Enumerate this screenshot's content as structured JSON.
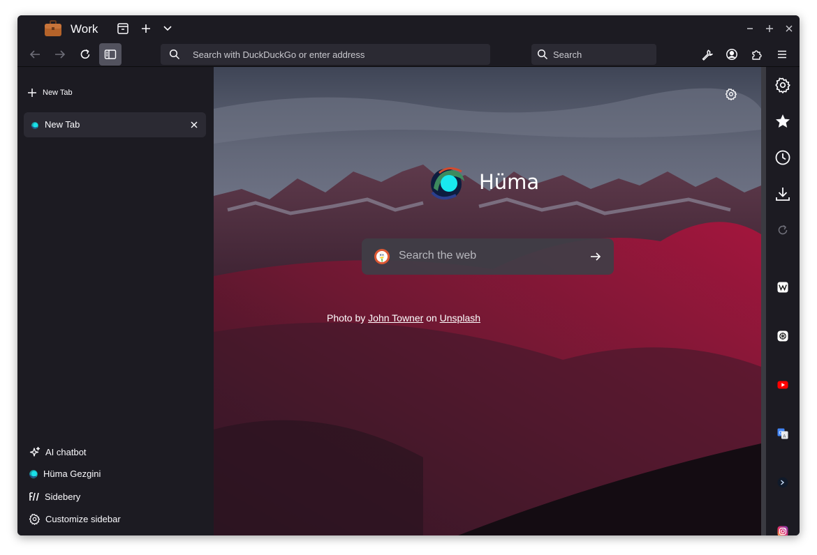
{
  "titlebar": {
    "workspace": "Work"
  },
  "navbar": {
    "url_placeholder": "Search with DuckDuckGo or enter address",
    "search_placeholder": "Search"
  },
  "sidebar": {
    "new_tab_label": "New Tab",
    "tabs": [
      {
        "label": "New Tab"
      }
    ],
    "tools": [
      {
        "label": "AI chatbot"
      },
      {
        "label": "Hüma Gezgini"
      },
      {
        "label": "Sidebery"
      },
      {
        "label": "Customize sidebar"
      }
    ]
  },
  "newtab": {
    "brand": "Hüma",
    "search_placeholder": "Search the web",
    "credit": {
      "prefix": "Photo by",
      "author": "John Towner",
      "middle": "on",
      "site": "Unsplash"
    }
  },
  "colors": {
    "chrome_bg": "#1c1b22",
    "field_bg": "#2b2a33",
    "accent_teal": "#19e0e8",
    "youtube_red": "#ff0000"
  }
}
